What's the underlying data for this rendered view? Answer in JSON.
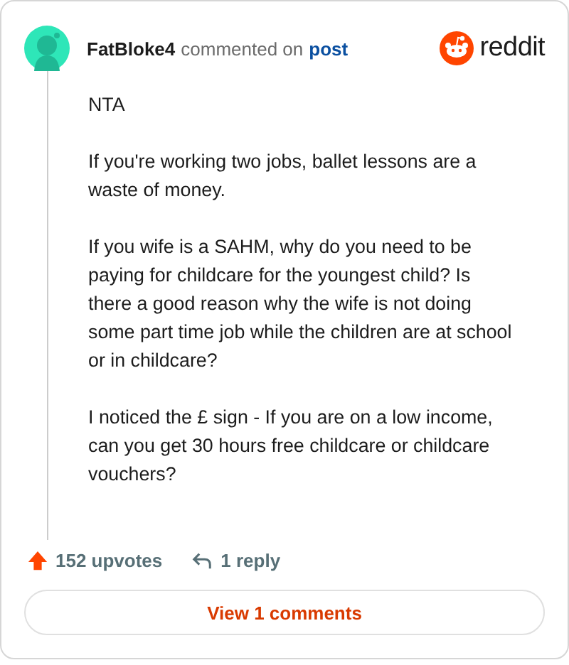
{
  "comment": {
    "author": "FatBloke4",
    "action": "commented on",
    "link": "post",
    "brand": "reddit",
    "paragraphs": [
      "NTA",
      "If you're working two jobs, ballet lessons are a waste of money.",
      "If you wife is a SAHM, why do you need to be paying for childcare for the youngest child? Is there a good reason why the wife is not doing some part time job while the children are at school or in childcare?",
      "I noticed the £ sign - If you are on a low income, can you get 30 hours free childcare or childcare vouchers?"
    ],
    "upvotes": "152 upvotes",
    "replies": "1 reply",
    "view_button": "View 1 comments"
  }
}
